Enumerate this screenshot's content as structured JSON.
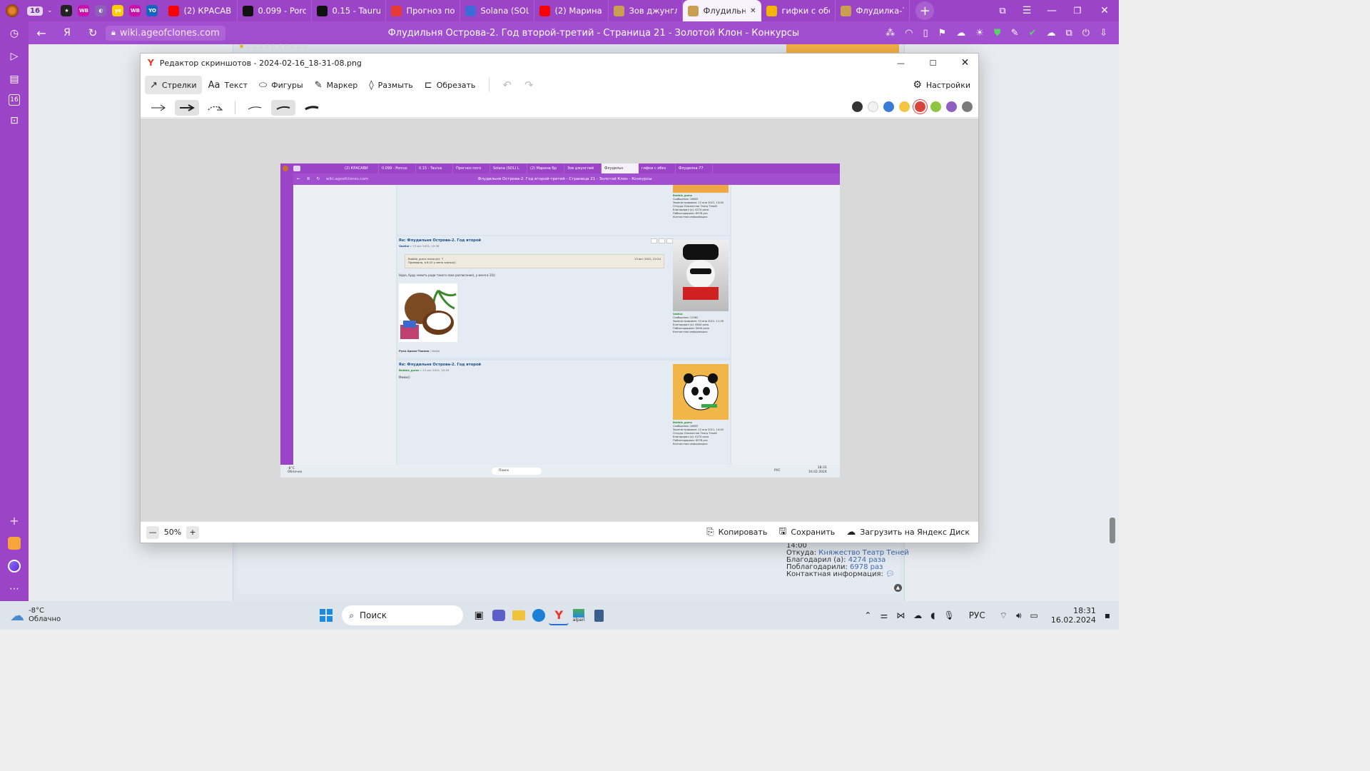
{
  "browser": {
    "tab_count": "16",
    "tabs": [
      {
        "label": "(2) КРАСАВИЦ",
        "fav": "youtube-icon",
        "color": "#ff0000"
      },
      {
        "label": "0.099 - Porcus",
        "fav": "taurus-icon",
        "color": "#111111"
      },
      {
        "label": "0.15 - Taurus G",
        "fav": "taurus-icon",
        "color": "#111111"
      },
      {
        "label": "Прогноз пого",
        "fav": "weather-icon",
        "color": "#e53935"
      },
      {
        "label": "Solana (SOL) L",
        "fav": "coinmarket-icon",
        "color": "#3f6bd8"
      },
      {
        "label": "(2) Марина Бр",
        "fav": "youtube-icon",
        "color": "#ff0000"
      },
      {
        "label": "Зов джунглей",
        "fav": "ageofclones-icon",
        "color": "#c8a050"
      },
      {
        "label": "Флудильня",
        "fav": "ageofclones-icon",
        "color": "#c8a050",
        "active": true
      },
      {
        "label": "гифки с обезь",
        "fav": "yandex-images-icon",
        "color": "#f4b400"
      },
      {
        "label": "Флудилка-77",
        "fav": "ageofclones-icon",
        "color": "#c8a050"
      }
    ],
    "pinned": [
      {
        "name": "star-pin-icon",
        "text": "★",
        "color": "#222222"
      },
      {
        "name": "wildberries-icon",
        "text": "WB",
        "color": "#cb11ab"
      },
      {
        "name": "circle-pin-icon",
        "text": "◐",
        "color": "#8d5fb8"
      },
      {
        "name": "yo-pin-icon",
        "text": "ye",
        "color": "#ffcc00"
      },
      {
        "name": "wildberries-icon-2",
        "text": "WB",
        "color": "#cb11ab"
      },
      {
        "name": "yo-icon",
        "text": "YO",
        "color": "#1565c0"
      }
    ],
    "address": "wiki.ageofclones.com",
    "page_title": "Флудильня Острова-2. Год второй-третий - Страница 21 - Золотой Клон - Конкурсы"
  },
  "behind_profile": {
    "line1": "14:00",
    "from_label": "Откуда:",
    "from_value": "Княжество Театр Теней",
    "thanked_label": "Благодарил (а):",
    "thanked_value": "4274 раза",
    "thanks_label": "Поблагодарили:",
    "thanks_value": "6978 раз",
    "contact_label": "Контактная информация:"
  },
  "editor": {
    "title": "Редактор скриншотов - 2024-02-16_18-31-08.png",
    "tools": [
      {
        "label": "Стрелки",
        "icon": "arrow-tool-icon",
        "active": true
      },
      {
        "label": "Текст",
        "icon": "text-tool-icon"
      },
      {
        "label": "Фигуры",
        "icon": "shapes-tool-icon"
      },
      {
        "label": "Маркер",
        "icon": "marker-tool-icon"
      },
      {
        "label": "Размыть",
        "icon": "blur-tool-icon"
      },
      {
        "label": "Обрезать",
        "icon": "crop-tool-icon"
      }
    ],
    "text_prefix": "Aa",
    "settings_label": "Настройки",
    "colors": [
      "#333333",
      "#f2f2f2",
      "#3a7bd5",
      "#f4c542",
      "#d9443a",
      "#8dc63f",
      "#8e5fc0",
      "#7a7a7a"
    ],
    "selected_color": "#d9443a",
    "zoom": "50%",
    "copy_label": "Копировать",
    "save_label": "Сохранить",
    "upload_label": "Загрузить на Яндекс Диск"
  },
  "mini": {
    "address": "wiki.ageofclones.com",
    "title": "Флудильня Острова-2. Год второй-третий - Страница 21 - Золотой Клон - Конкурсы",
    "tabs": [
      "(2) КРАСАВИ",
      "0.099 - Porcus",
      "0.15 - Taurus",
      "Прогноз пого",
      "Solana (SOL) L",
      "(2) Марина Бр",
      "Зов джунглей",
      "Флудильн",
      "гифки с обез",
      "Флудилка-77"
    ],
    "post1": {
      "title": "Re: Флудильня Острова-2. Год второй",
      "meta_user": "VasKul",
      "meta_date": "» 13 окт 2022, 22:28",
      "quote_author": "Bubble_gums писал(а): ↑",
      "quote_date": "13 окт 2022, 22:24",
      "quote_text": "Примерно, в 6:15 у меня завтра))",
      "text": "Ндаа, буду немить ради такого свое расписание), у меня в 10))",
      "signature": "Рука Аркон-Такеня",
      "signature_user": "/ VasKa"
    },
    "prof_vaskul": {
      "name": "VasKul",
      "l1": "Сообщения: 11562",
      "l2": "Зарегистрирован: 24 апр 2021, 11:26",
      "l3": "Благодарил (а): 4844 раза",
      "l4": "Поблагодарили: 5644 раза",
      "l5": "Контактная информация:"
    },
    "post2": {
      "title": "Re: Флудильня Острова-2. Год второй",
      "meta_user": "Bubble_gums",
      "meta_date": "» 13 окт 2022, 22:29",
      "text": "Мммм))"
    },
    "prof_bubble": {
      "name": "Bubble_gums",
      "l1": "Сообщения: 16655",
      "l2": "Зарегистрирован: 12 апр 2021, 14:00",
      "l3": "Откуда: Княжество Театр Теней",
      "l4": "Благодарил (а): 4274 раза",
      "l5": "Поблагодарили: 6978 раз",
      "l6": "Контактная информация:"
    },
    "task_weather": "-8°C",
    "task_weather2": "Облачно",
    "task_search": "Поиск",
    "task_lang": "РУС",
    "task_time": "18:31",
    "task_date": "16.02.2024"
  },
  "taskbar": {
    "temp": "-8°C",
    "condition": "Облачно",
    "search_placeholder": "Поиск",
    "lang": "РУС",
    "time": "18:31",
    "date": "16.02.2024",
    "alpari_label": "alpari"
  }
}
